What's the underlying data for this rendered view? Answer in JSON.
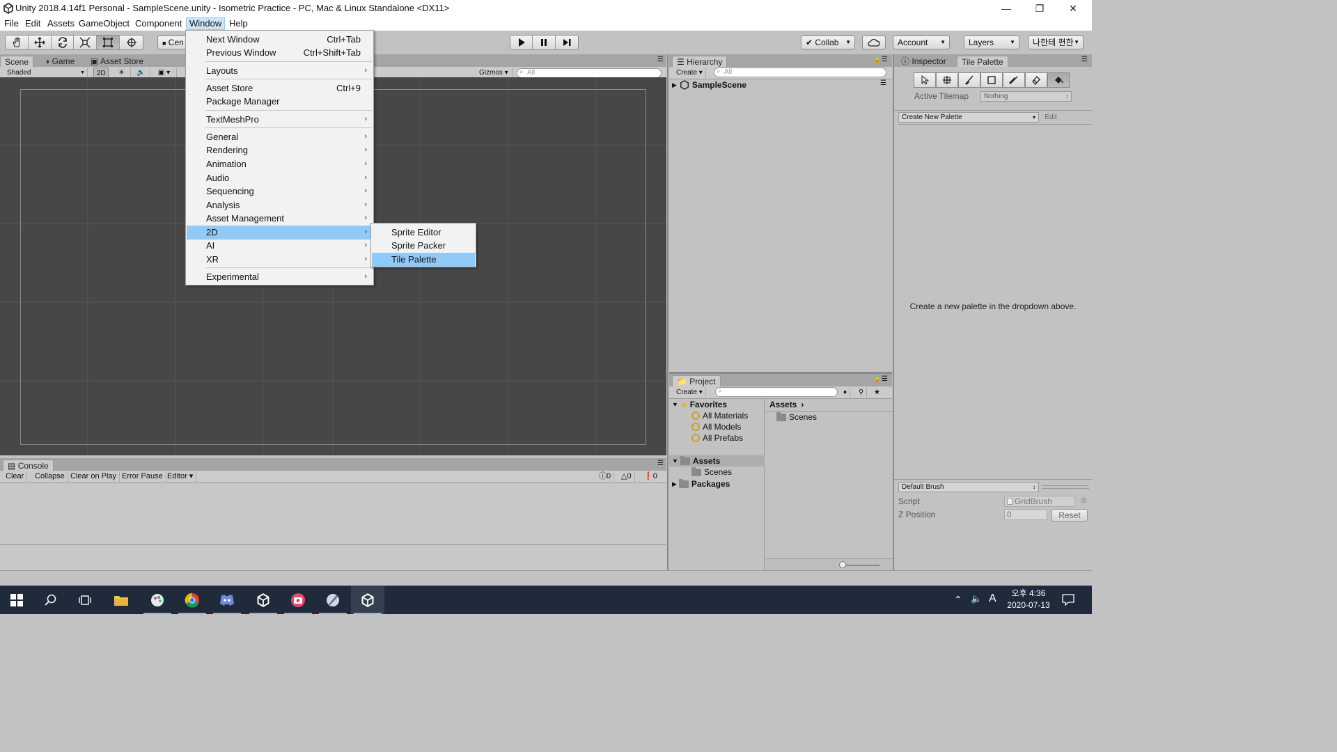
{
  "window": {
    "title": "Unity 2018.4.14f1 Personal - SampleScene.unity - Isometric Practice - PC, Mac & Linux Standalone <DX11>"
  },
  "menubar": [
    "File",
    "Edit",
    "Assets",
    "GameObject",
    "Component",
    "Window",
    "Help"
  ],
  "toolbar": {
    "pivot_label": "Cen",
    "collab": "Collab",
    "account": "Account",
    "layers": "Layers",
    "layout": "나한테 편한"
  },
  "scene_panel": {
    "tabs": [
      "Scene",
      "Game",
      "Asset Store"
    ],
    "shading": "Shaded",
    "mode_2d": "2D",
    "gizmos": "Gizmos",
    "search_placeholder": "All"
  },
  "console": {
    "tab": "Console",
    "buttons": [
      "Clear",
      "Collapse",
      "Clear on Play",
      "Error Pause",
      "Editor"
    ],
    "counts": {
      "info": "0",
      "warn": "0",
      "error": "0"
    }
  },
  "window_menu": {
    "items": [
      {
        "label": "Next Window",
        "shortcut": "Ctrl+Tab"
      },
      {
        "label": "Previous Window",
        "shortcut": "Ctrl+Shift+Tab"
      },
      {
        "label": "Layouts",
        "submenu": true
      },
      {
        "label": "Asset Store",
        "shortcut": "Ctrl+9"
      },
      {
        "label": "Package Manager"
      },
      {
        "label": "TextMeshPro",
        "submenu": true
      },
      {
        "label": "General",
        "submenu": true
      },
      {
        "label": "Rendering",
        "submenu": true
      },
      {
        "label": "Animation",
        "submenu": true
      },
      {
        "label": "Audio",
        "submenu": true
      },
      {
        "label": "Sequencing",
        "submenu": true
      },
      {
        "label": "Analysis",
        "submenu": true
      },
      {
        "label": "Asset Management",
        "submenu": true
      },
      {
        "label": "2D",
        "submenu": true,
        "highlighted": true
      },
      {
        "label": "AI",
        "submenu": true
      },
      {
        "label": "XR",
        "submenu": true
      },
      {
        "label": "Experimental",
        "submenu": true
      }
    ]
  },
  "submenu_2d": {
    "items": [
      {
        "label": "Sprite Editor"
      },
      {
        "label": "Sprite Packer"
      },
      {
        "label": "Tile Palette",
        "highlighted": true
      }
    ]
  },
  "hierarchy": {
    "tab": "Hierarchy",
    "create": "Create",
    "search_placeholder": "All",
    "scene": "SampleScene"
  },
  "project": {
    "tab": "Project",
    "create": "Create",
    "favorites_label": "Favorites",
    "favorites": [
      "All Materials",
      "All Models",
      "All Prefabs"
    ],
    "assets_label": "Assets",
    "assets_children": [
      "Scenes"
    ],
    "packages_label": "Packages",
    "breadcrumb": "Assets",
    "content": [
      "Scenes"
    ]
  },
  "inspector": {
    "tabs": [
      "Inspector",
      "Tile Palette"
    ],
    "active_tilemap_label": "Active Tilemap",
    "active_tilemap_value": "Nothing",
    "palette_dropdown": "Create New Palette",
    "edit": "Edit",
    "empty_message": "Create a new palette in the dropdown above.",
    "brush": "Default Brush",
    "script_label": "Script",
    "script_value": "GridBrush",
    "zpos_label": "Z Position",
    "zpos_value": "0",
    "reset": "Reset"
  },
  "taskbar": {
    "clock_time": "오후 4:36",
    "clock_date": "2020-07-13",
    "ime": "A"
  }
}
